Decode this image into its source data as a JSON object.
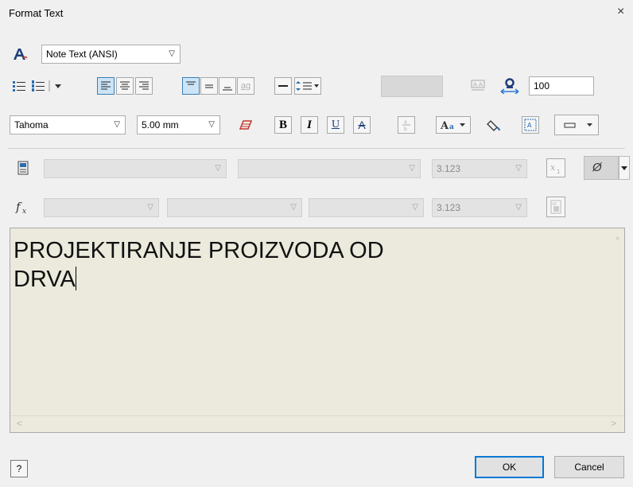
{
  "window": {
    "title": "Format Text",
    "close_glyph": "×"
  },
  "row1": {
    "style_select": "Note Text (ANSI)"
  },
  "row2": {
    "stack_glyph": "ag",
    "width_value": "100"
  },
  "row3": {
    "font_select": "Tahoma",
    "size_select": "5.00 mm",
    "bold": "B",
    "italic": "I",
    "underline": "U",
    "strike": "A"
  },
  "row4": {
    "field3": "3.123",
    "symbol_glyph": "Ø"
  },
  "row5": {
    "field3": "3.123"
  },
  "editor": {
    "lines": [
      "PROJEKTIRANJE PROIZVODA OD",
      "DRVA"
    ]
  },
  "buttons": {
    "ok": "OK",
    "cancel": "Cancel",
    "help": "?"
  },
  "colors": {
    "editor_bg": "#ebeadc",
    "active_button": "#cce4f7",
    "primary_border": "#0078d7"
  }
}
